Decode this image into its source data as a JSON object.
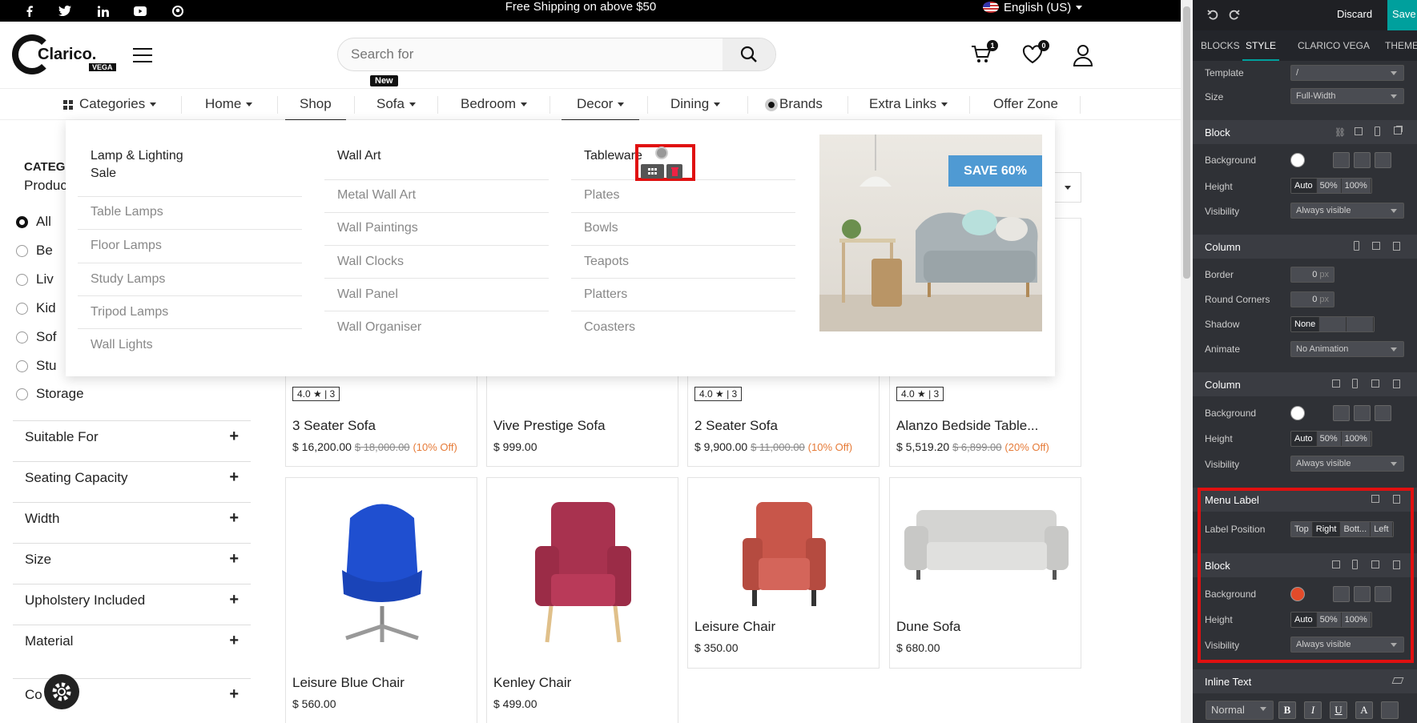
{
  "topbar": {
    "shipping": "Free Shipping on above $50",
    "language": "English (US)"
  },
  "header": {
    "logo_text": "Clarico.",
    "logo_sub": "VEGA",
    "search_placeholder": "Search for",
    "cart_count": "1",
    "wishlist_count": "0"
  },
  "nav": {
    "items": [
      "Categories",
      "Home",
      "Shop",
      "Sofa",
      "Bedroom",
      "Decor",
      "Dining",
      "Brands",
      "Extra Links",
      "Offer Zone"
    ],
    "new_badge": "New"
  },
  "megamenu": {
    "col1": {
      "head": "Lamp & Lighting Sale",
      "subs": [
        "Table Lamps",
        "Floor Lamps",
        "Study Lamps",
        "Tripod Lamps",
        "Wall Lights"
      ]
    },
    "col2": {
      "head": "Wall Art",
      "subs": [
        "Metal Wall Art",
        "Wall Paintings",
        "Wall Clocks",
        "Wall Panel",
        "Wall Organiser"
      ]
    },
    "col3": {
      "head": "Tableware",
      "subs": [
        "Plates",
        "Bowls",
        "Teapots",
        "Platters",
        "Coasters"
      ]
    },
    "promo": "SAVE 60%"
  },
  "sidebar": {
    "title": "CATEG",
    "sub": "Produc",
    "radios": [
      "All",
      "Be",
      "Liv",
      "Kid",
      "Sof",
      "Stu",
      "Storage"
    ],
    "facets": [
      "Suitable For",
      "Seating Capacity",
      "Width",
      "Size",
      "Upholstery Included",
      "Material",
      "Co"
    ]
  },
  "products": {
    "row1": [
      {
        "rating": "4.0 ★ | 3",
        "name": "3 Seater Sofa",
        "price": "$ 16,200.00",
        "old": "$ 18,000.00",
        "off": "(10% Off)"
      },
      {
        "name": "Vive Prestige Sofa",
        "price": "$ 999.00"
      },
      {
        "rating": "4.0 ★ | 3",
        "name": "2 Seater Sofa",
        "price": "$ 9,900.00",
        "old": "$ 11,000.00",
        "off": "(10% Off)"
      },
      {
        "rating": "4.0 ★ | 3",
        "name": "Alanzo Bedside Table...",
        "price": "$ 5,519.20",
        "old": "$ 6,899.00",
        "off": "(20% Off)"
      }
    ],
    "row2": [
      {
        "name": "Leisure Blue Chair",
        "price": "$ 560.00"
      },
      {
        "name": "Kenley Chair",
        "price": "$ 499.00"
      },
      {
        "name": "Leisure Chair",
        "price": "$ 350.00"
      },
      {
        "name": "Dune Sofa",
        "price": "$ 680.00"
      }
    ]
  },
  "panel": {
    "discard": "Discard",
    "save": "Save",
    "tabs": [
      "BLOCKS",
      "STYLE",
      "CLARICO VEGA",
      "THEME"
    ],
    "template_label": "Template",
    "template_value": "/",
    "size_label": "Size",
    "size_value": "Full-Width",
    "block1": {
      "title": "Block",
      "bg": "Background",
      "height": "Height",
      "visibility": "Visibility",
      "vis_value": "Always visible"
    },
    "column1": {
      "title": "Column",
      "border": "Border",
      "round": "Round Corners",
      "shadow": "Shadow",
      "animate": "Animate",
      "animate_value": "No Animation",
      "shadow_none": "None",
      "zero": "0",
      "px": "px"
    },
    "column2": {
      "title": "Column",
      "bg": "Background",
      "height": "Height",
      "visibility": "Visibility",
      "vis_value": "Always visible"
    },
    "menu_label": {
      "title": "Menu Label",
      "pos_label": "Label Position",
      "options": [
        "Top",
        "Right",
        "Bott...",
        "Left"
      ]
    },
    "block2": {
      "title": "Block",
      "bg": "Background",
      "height": "Height",
      "visibility": "Visibility",
      "vis_value": "Always visible",
      "color": "#e34b2a"
    },
    "inline_text": {
      "title": "Inline Text",
      "style_value": "Normal"
    },
    "height_opts": [
      "Auto",
      "50%",
      "100%"
    ]
  }
}
